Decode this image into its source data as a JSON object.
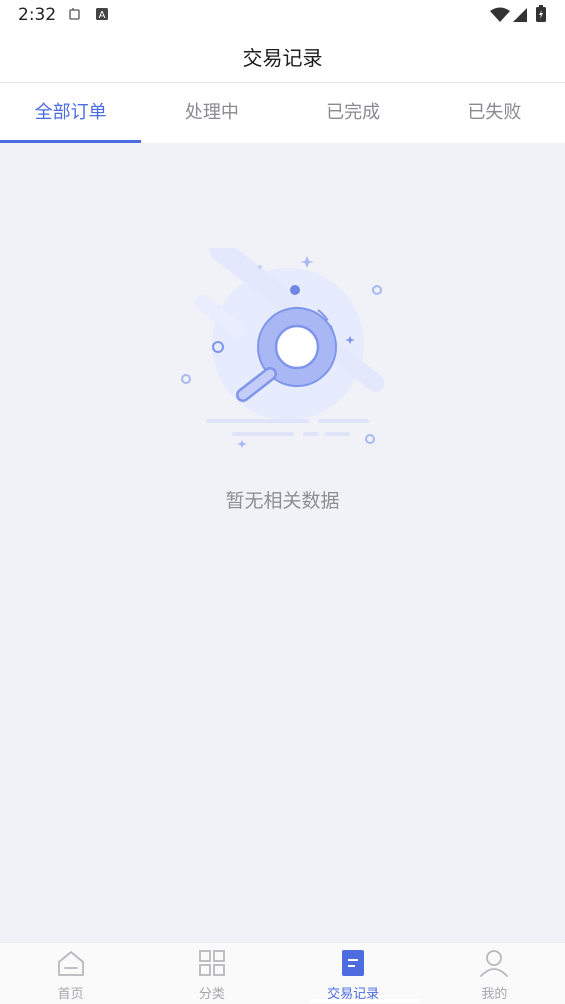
{
  "status_bar": {
    "time": "2:32",
    "icons": [
      "notification-icon",
      "text-a-icon",
      "wifi-icon",
      "cellular-signal-icon",
      "battery-icon"
    ]
  },
  "header": {
    "title": "交易记录"
  },
  "tabs": [
    {
      "label": "全部订单",
      "active": true
    },
    {
      "label": "处理中",
      "active": false
    },
    {
      "label": "已完成",
      "active": false
    },
    {
      "label": "已失败",
      "active": false
    }
  ],
  "empty_state": {
    "message": "暂无相关数据",
    "icon": "magnifier-empty-illustration"
  },
  "bottom_nav": [
    {
      "label": "首页",
      "icon": "home-icon",
      "active": false
    },
    {
      "label": "分类",
      "icon": "grid-icon",
      "active": false
    },
    {
      "label": "交易记录",
      "icon": "document-icon",
      "active": true
    },
    {
      "label": "我的",
      "icon": "user-icon",
      "active": false
    }
  ],
  "colors": {
    "accent": "#4c6ce0",
    "background": "#f1f2f7",
    "illustration": "#a9b8f5"
  }
}
